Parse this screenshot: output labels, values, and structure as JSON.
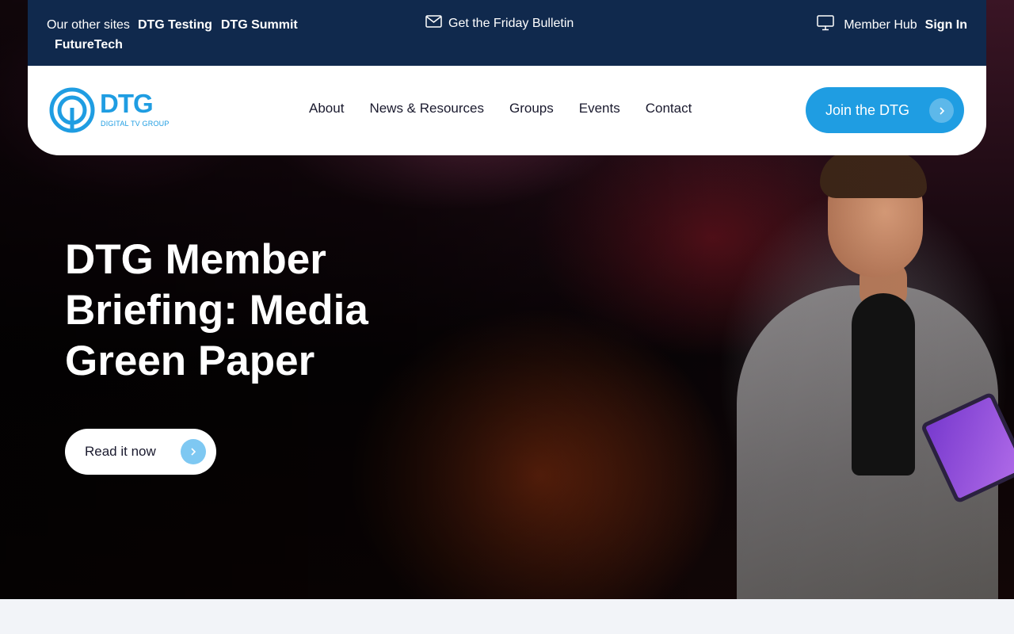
{
  "topbar": {
    "other_sites_label": "Our other sites",
    "sites": [
      "DTG Testing",
      "DTG Summit",
      "FutureTech"
    ],
    "bulletin_label": "Get the Friday Bulletin",
    "member_hub_label": "Member Hub",
    "sign_in_label": "Sign In"
  },
  "header": {
    "logo_text": "DTG",
    "logo_tagline": "DIGITAL TV GROUP",
    "nav": [
      "About",
      "News & Resources",
      "Groups",
      "Events",
      "Contact"
    ],
    "join_label": "Join the DTG"
  },
  "hero": {
    "title": "DTG Member Briefing: Media Green Paper",
    "cta_label": "Read it now"
  },
  "colors": {
    "navy": "#10294d",
    "accent_blue": "#1f9de2",
    "light_blue": "#7ec8f2"
  },
  "icons": [
    "mail-icon",
    "monitor-icon",
    "chevron-right-icon",
    "dtg-logo-icon"
  ]
}
